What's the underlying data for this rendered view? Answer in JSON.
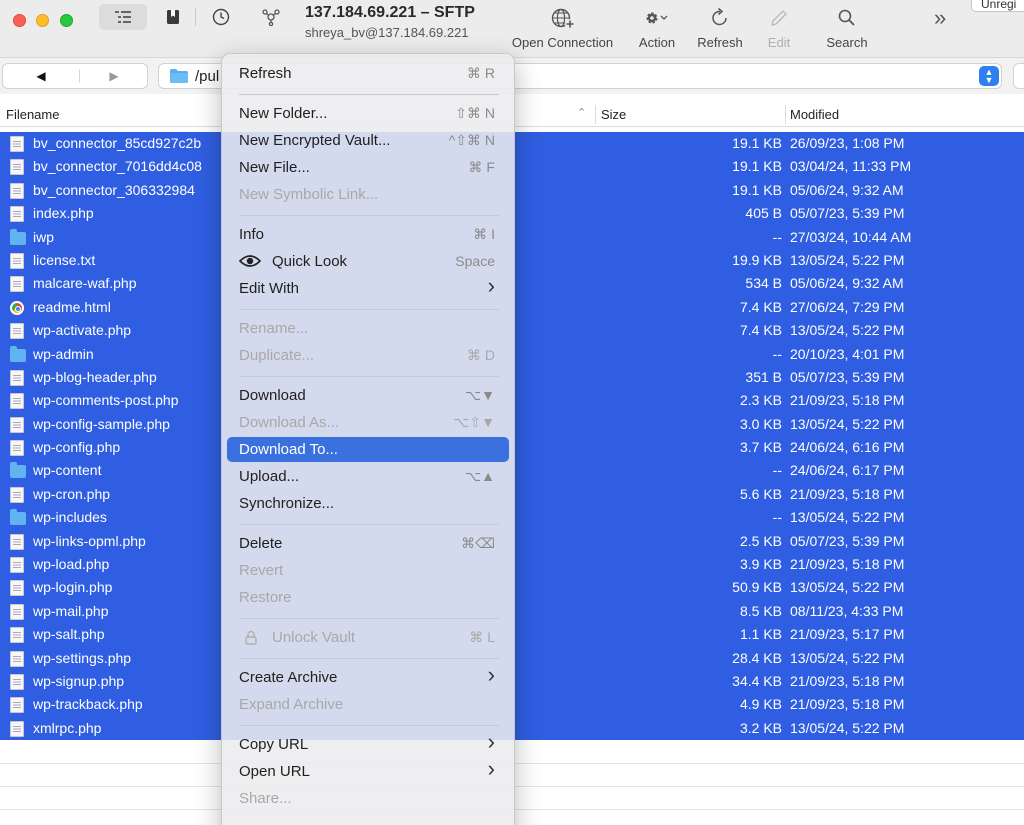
{
  "window": {
    "title": "137.184.69.221 – SFTP",
    "subtitle": "shreya_bv@137.184.69.221"
  },
  "toolbar": {
    "open_connection": "Open Connection",
    "action": "Action",
    "refresh": "Refresh",
    "edit": "Edit",
    "search": "Search",
    "more": "»",
    "unregistered": "Unregi"
  },
  "nav": {
    "back": "◀",
    "forward": "▶",
    "path": "/pul"
  },
  "columns": {
    "filename": "Filename",
    "size": "Size",
    "modified": "Modified"
  },
  "files": [
    {
      "name": "bv_connector_85cd927c2b",
      "size": "19.1 KB",
      "modified": "26/09/23, 1:08 PM",
      "type": "doc"
    },
    {
      "name": "bv_connector_7016dd4c08",
      "size": "19.1 KB",
      "modified": "03/04/24, 11:33 PM",
      "type": "doc"
    },
    {
      "name": "bv_connector_306332984",
      "size": "19.1 KB",
      "modified": "05/06/24, 9:32 AM",
      "type": "doc"
    },
    {
      "name": "index.php",
      "size": "405 B",
      "modified": "05/07/23, 5:39 PM",
      "type": "doc"
    },
    {
      "name": "iwp",
      "size": "--",
      "modified": "27/03/24, 10:44 AM",
      "type": "folder"
    },
    {
      "name": "license.txt",
      "size": "19.9 KB",
      "modified": "13/05/24, 5:22 PM",
      "type": "doc"
    },
    {
      "name": "malcare-waf.php",
      "size": "534 B",
      "modified": "05/06/24, 9:32 AM",
      "type": "doc"
    },
    {
      "name": "readme.html",
      "size": "7.4 KB",
      "modified": "27/06/24, 7:29 PM",
      "type": "web"
    },
    {
      "name": "wp-activate.php",
      "size": "7.4 KB",
      "modified": "13/05/24, 5:22 PM",
      "type": "doc"
    },
    {
      "name": "wp-admin",
      "size": "--",
      "modified": "20/10/23, 4:01 PM",
      "type": "folder"
    },
    {
      "name": "wp-blog-header.php",
      "size": "351 B",
      "modified": "05/07/23, 5:39 PM",
      "type": "doc"
    },
    {
      "name": "wp-comments-post.php",
      "size": "2.3 KB",
      "modified": "21/09/23, 5:18 PM",
      "type": "doc"
    },
    {
      "name": "wp-config-sample.php",
      "size": "3.0 KB",
      "modified": "13/05/24, 5:22 PM",
      "type": "doc"
    },
    {
      "name": "wp-config.php",
      "size": "3.7 KB",
      "modified": "24/06/24, 6:16 PM",
      "type": "doc"
    },
    {
      "name": "wp-content",
      "size": "--",
      "modified": "24/06/24, 6:17 PM",
      "type": "folder"
    },
    {
      "name": "wp-cron.php",
      "size": "5.6 KB",
      "modified": "21/09/23, 5:18 PM",
      "type": "doc"
    },
    {
      "name": "wp-includes",
      "size": "--",
      "modified": "13/05/24, 5:22 PM",
      "type": "folder"
    },
    {
      "name": "wp-links-opml.php",
      "size": "2.5 KB",
      "modified": "05/07/23, 5:39 PM",
      "type": "doc"
    },
    {
      "name": "wp-load.php",
      "size": "3.9 KB",
      "modified": "21/09/23, 5:18 PM",
      "type": "doc"
    },
    {
      "name": "wp-login.php",
      "size": "50.9 KB",
      "modified": "13/05/24, 5:22 PM",
      "type": "doc"
    },
    {
      "name": "wp-mail.php",
      "size": "8.5 KB",
      "modified": "08/11/23, 4:33 PM",
      "type": "doc"
    },
    {
      "name": "wp-salt.php",
      "size": "1.1 KB",
      "modified": "21/09/23, 5:17 PM",
      "type": "doc"
    },
    {
      "name": "wp-settings.php",
      "size": "28.4 KB",
      "modified": "13/05/24, 5:22 PM",
      "type": "doc"
    },
    {
      "name": "wp-signup.php",
      "size": "34.4 KB",
      "modified": "21/09/23, 5:18 PM",
      "type": "doc"
    },
    {
      "name": "wp-trackback.php",
      "size": "4.9 KB",
      "modified": "21/09/23, 5:18 PM",
      "type": "doc"
    },
    {
      "name": "xmlrpc.php",
      "size": "3.2 KB",
      "modified": "13/05/24, 5:22 PM",
      "type": "doc"
    }
  ],
  "menu": [
    {
      "label": "Refresh",
      "shortcut": "⌘ R"
    },
    {
      "sep": true
    },
    {
      "label": "New Folder...",
      "shortcut": "⇧⌘ N"
    },
    {
      "label": "New Encrypted Vault...",
      "shortcut": "^⇧⌘ N"
    },
    {
      "label": "New File...",
      "shortcut": "⌘ F"
    },
    {
      "label": "New Symbolic Link...",
      "disabled": true
    },
    {
      "sep": true
    },
    {
      "label": "Info",
      "shortcut": "⌘ I"
    },
    {
      "label": "Quick Look",
      "shortcut": "Space",
      "icon": "eye-icon"
    },
    {
      "label": "Edit With",
      "submenu": true
    },
    {
      "sep": true
    },
    {
      "label": "Rename...",
      "disabled": true
    },
    {
      "label": "Duplicate...",
      "shortcut": "⌘ D",
      "disabled": true
    },
    {
      "sep": true
    },
    {
      "label": "Download",
      "shortcut": "⌥▼"
    },
    {
      "label": "Download As...",
      "shortcut": "⌥⇧▼",
      "disabled": true
    },
    {
      "label": "Download To...",
      "highlight": true
    },
    {
      "label": "Upload...",
      "shortcut": "⌥▲"
    },
    {
      "label": "Synchronize..."
    },
    {
      "sep": true
    },
    {
      "label": "Delete",
      "shortcut": "⌘⌫"
    },
    {
      "label": "Revert",
      "disabled": true
    },
    {
      "label": "Restore",
      "disabled": true
    },
    {
      "sep": true
    },
    {
      "label": "Unlock Vault",
      "shortcut": "⌘ L",
      "disabled": true,
      "icon": "lock-icon"
    },
    {
      "sep": true
    },
    {
      "label": "Create Archive",
      "submenu": true
    },
    {
      "label": "Expand Archive",
      "disabled": true
    },
    {
      "sep": true
    },
    {
      "label": "Copy URL",
      "submenu": true
    },
    {
      "label": "Open URL",
      "submenu": true
    },
    {
      "label": "Share...",
      "disabled": true
    }
  ],
  "colors": {
    "selection": "#2f5ee2",
    "menu_highlight": "#3a71df",
    "accent": "#2f7ff0"
  }
}
